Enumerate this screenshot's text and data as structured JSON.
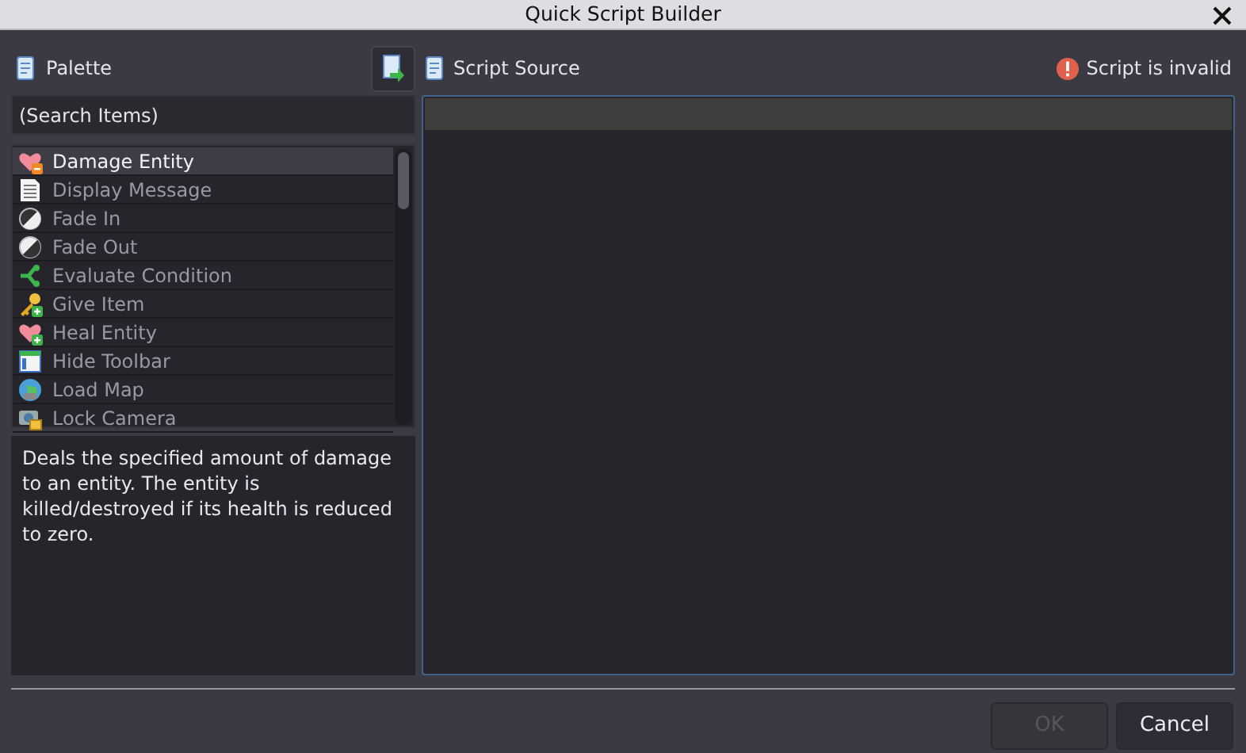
{
  "window": {
    "title": "Quick Script Builder"
  },
  "palette": {
    "title": "Palette",
    "search": {
      "placeholder": "(Search Items)"
    },
    "items": [
      {
        "label": "Damage Entity",
        "selected": true
      },
      {
        "label": "Display Message",
        "selected": false
      },
      {
        "label": "Fade In",
        "selected": false
      },
      {
        "label": "Fade Out",
        "selected": false
      },
      {
        "label": "Evaluate Condition",
        "selected": false
      },
      {
        "label": "Give Item",
        "selected": false
      },
      {
        "label": "Heal Entity",
        "selected": false
      },
      {
        "label": "Hide Toolbar",
        "selected": false
      },
      {
        "label": "Load Map",
        "selected": false
      },
      {
        "label": "Lock Camera",
        "selected": false
      }
    ],
    "description": "Deals the specified amount of damage to an entity. The entity is killed/destroyed if its health is reduced to zero."
  },
  "source": {
    "title": "Script Source",
    "status": "Script is invalid"
  },
  "buttons": [
    {
      "label": "OK",
      "disabled": true
    },
    {
      "label": "Cancel",
      "disabled": false
    }
  ]
}
